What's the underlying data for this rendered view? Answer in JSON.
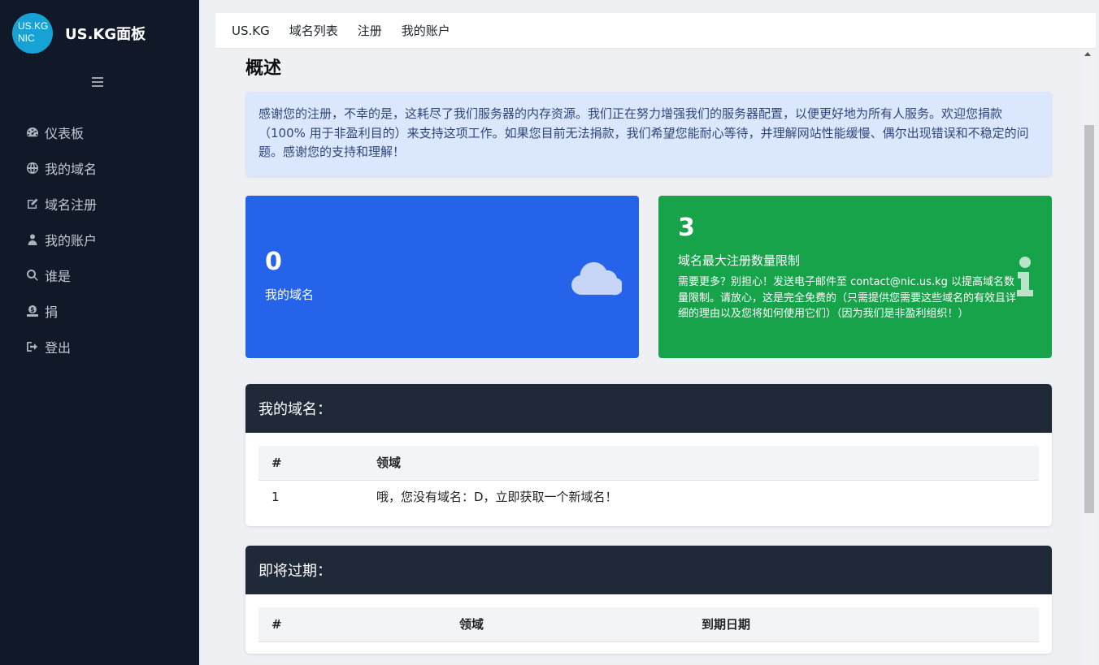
{
  "sidebar": {
    "logo_line1": "US.KG",
    "logo_line2": "NIC",
    "brand": "US.KG面板",
    "items": [
      {
        "label": "仪表板",
        "icon": "dashboard-icon"
      },
      {
        "label": "我的域名",
        "icon": "globe-icon"
      },
      {
        "label": "域名注册",
        "icon": "edit-icon"
      },
      {
        "label": "我的账户",
        "icon": "user-icon"
      },
      {
        "label": "谁是",
        "icon": "search-icon"
      },
      {
        "label": "捐",
        "icon": "donate-icon"
      },
      {
        "label": "登出",
        "icon": "sign-out-icon"
      }
    ]
  },
  "topbar": {
    "links": [
      "US.KG",
      "域名列表",
      "注册",
      "我的账户"
    ]
  },
  "main": {
    "title": "概述",
    "alert": "感谢您的注册，不幸的是，这耗尽了我们服务器的内存资源。我们正在努力增强我们的服务器配置，以便更好地为所有人服务。欢迎您捐款（100% 用于非盈利目的）来支持这项工作。如果您目前无法捐款，我们希望您能耐心等待，并理解网站性能缓慢、偶尔出现错误和不稳定的问题。感谢您的支持和理解！",
    "card_domains": {
      "value": "0",
      "label": "我的域名",
      "icon": "cloud-icon",
      "color": "#2563eb"
    },
    "card_limit": {
      "value": "3",
      "label": "域名最大注册数量限制",
      "description": "需要更多？别担心！发送电子邮件至 contact@nic.us.kg 以提高域名数量限制。请放心，这是完全免费的（只需提供您需要这些域名的有效且详细的理由以及您将如何使用它们）（因为我们是非盈利组织！）",
      "icon": "info-icon",
      "color": "#16a34a"
    },
    "my_domains": {
      "title": "我的域名：",
      "columns": [
        "#",
        "领域"
      ],
      "rows": [
        [
          "1",
          "哦，您没有域名：D，立即获取一个新域名！"
        ]
      ]
    },
    "expiring": {
      "title": "即将过期：",
      "columns": [
        "#",
        "领域",
        "到期日期"
      ]
    }
  }
}
